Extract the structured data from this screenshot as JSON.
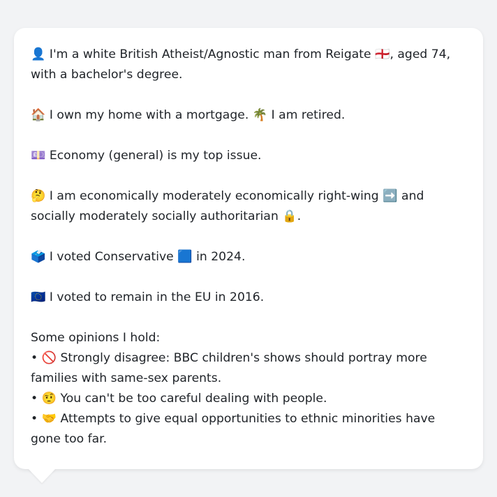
{
  "profile": {
    "identity": {
      "icon": "👤",
      "text": "I'm a white British Atheist/Agnostic man from Reigate",
      "flag": "🏴󠁧󠁢󠁥󠁮󠁧󠁿",
      "suffix": ", aged 74, with a bachelor's degree."
    },
    "home": {
      "icon": "🏠",
      "text": "I own my home with a mortgage.",
      "icon2": "🌴",
      "text2": "I am retired."
    },
    "issue": {
      "icon": "💷",
      "text": "Economy (general) is my top issue."
    },
    "ideology": {
      "icon": "🤔",
      "text": "I am economically moderately economically right-wing",
      "icon2": "➡️",
      "text2": "and socially moderately socially authoritarian",
      "icon3": "🔒",
      "end": "."
    },
    "vote2024": {
      "icon": "🗳️",
      "text": "I voted Conservative",
      "icon2": "🟦",
      "text2": "in 2024."
    },
    "brexit": {
      "icon": "🇪🇺",
      "text": "I voted to remain in the EU in 2016."
    },
    "opinions_heading": "Some opinions I hold:",
    "opinions": [
      {
        "bullet": "•",
        "icon": "🚫",
        "text": "Strongly disagree: BBC children's shows should portray more families with same-sex parents."
      },
      {
        "bullet": "•",
        "icon": "🤨",
        "text": "You can't be too careful dealing with people."
      },
      {
        "bullet": "•",
        "icon": "🤝",
        "text": "Attempts to give equal opportunities to ethnic minorities have gone too far."
      }
    ]
  }
}
